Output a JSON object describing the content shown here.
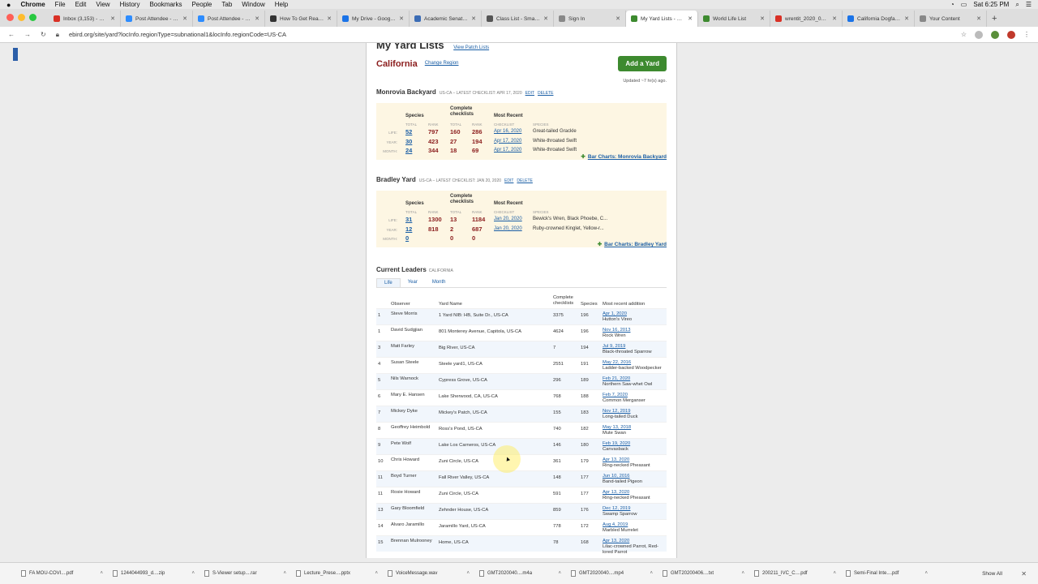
{
  "menubar": {
    "app": "Chrome",
    "items": [
      "File",
      "Edit",
      "View",
      "History",
      "Bookmarks",
      "People",
      "Tab",
      "Window",
      "Help"
    ],
    "clock": "Sat 6:25 PM"
  },
  "tabs": [
    {
      "label": "Inbox (3,153) - dev...",
      "color": "#d93025"
    },
    {
      "label": "Post Attendee - Zo...",
      "color": "#2d8cff"
    },
    {
      "label": "Post Attendee - Zo...",
      "color": "#2d8cff"
    },
    {
      "label": "How To Get Really...",
      "color": "#333333"
    },
    {
      "label": "My Drive - Google D...",
      "color": "#1a73e8"
    },
    {
      "label": "Academic Senate -...",
      "color": "#3b6cb5"
    },
    {
      "label": "Class List - Smartsh...",
      "color": "#555555"
    },
    {
      "label": "Sign In",
      "color": "#888888"
    },
    {
      "label": "My Yard Lists - eBi...",
      "color": "#3d8a2f",
      "active": true
    },
    {
      "label": "World Life List",
      "color": "#3d8a2f"
    },
    {
      "label": "wrentit_2020_04.p...",
      "color": "#d93025"
    },
    {
      "label": "California Dogface...",
      "color": "#1a73e8"
    },
    {
      "label": "Your Content",
      "color": "#888888"
    }
  ],
  "address": {
    "url": "ebird.org/site/yard?locInfo.regionType=subnational1&locInfo.regionCode=US-CA"
  },
  "page": {
    "title": "My Yard Lists",
    "view_patch": "View Patch Lists",
    "region": "California",
    "change_region": "Change Region",
    "add_yard": "Add a Yard",
    "updated": "Updated ~7 hr(s) ago."
  },
  "yards": [
    {
      "name": "Monrovia Backyard",
      "meta": "US-CA – LATEST CHECKLIST: APR 17, 2020",
      "edit": "EDIT",
      "delete": "DELETE",
      "hdr": {
        "species": "Species",
        "checklists": "Complete checklists",
        "recent": "Most Recent"
      },
      "sub": {
        "total": "TOTAL",
        "rank": "RANK",
        "checklist": "CHECKLIST",
        "species": "SPECIES"
      },
      "rows": [
        {
          "label": "LIFE:",
          "total": "52",
          "rank": "797",
          "ctotal": "160",
          "crank": "286",
          "date": "Apr 16, 2020",
          "species": "Great-tailed Grackle"
        },
        {
          "label": "YEAR:",
          "total": "30",
          "rank": "423",
          "ctotal": "27",
          "crank": "194",
          "date": "Apr 17, 2020",
          "species": "White-throated Swift"
        },
        {
          "label": "MONTH:",
          "total": "24",
          "rank": "344",
          "ctotal": "18",
          "crank": "69",
          "date": "Apr 17, 2020",
          "species": "White-throated Swift"
        }
      ],
      "bar": "Bar Charts: Monrovia Backyard"
    },
    {
      "name": "Bradley Yard",
      "meta": "US-CA – LATEST CHECKLIST: JAN 20, 2020",
      "edit": "EDIT",
      "delete": "DELETE",
      "hdr": {
        "species": "Species",
        "checklists": "Complete checklists",
        "recent": "Most Recent"
      },
      "sub": {
        "total": "TOTAL",
        "rank": "RANK",
        "checklist": "CHECKLIST",
        "species": "SPECIES"
      },
      "rows": [
        {
          "label": "LIFE:",
          "total": "31",
          "rank": "1300",
          "ctotal": "13",
          "crank": "1184",
          "date": "Jan 20, 2020",
          "species": "Bewick's Wren, Black Phoebe, C..."
        },
        {
          "label": "YEAR:",
          "total": "12",
          "rank": "818",
          "ctotal": "2",
          "crank": "687",
          "date": "Jan 20, 2020",
          "species": "Ruby-crowned Kinglet, Yellow-r..."
        },
        {
          "label": "MONTH:",
          "total": "0",
          "rank": "",
          "ctotal": "0",
          "crank": "0",
          "date": "",
          "species": ""
        }
      ],
      "bar": "Bar Charts: Bradley Yard"
    }
  ],
  "leaders": {
    "title": "Current Leaders",
    "region": "CALIFORNIA",
    "tabs": [
      "Life",
      "Year",
      "Month"
    ],
    "headers": {
      "observer": "Observer",
      "yard": "Yard Name",
      "checklists": "Complete checklists",
      "species": "Species",
      "recent": "Most recent addition"
    },
    "rows": [
      {
        "rank": "1",
        "observer": "Steve Morris",
        "yard": "1 Yard NIB: HB, Suite Dr., US-CA",
        "checklists": "3375",
        "species": "196",
        "date": "Apr 1, 2020",
        "bird": "Hutton's Vireo"
      },
      {
        "rank": "1",
        "observer": "David Sudgjian",
        "yard": "801 Monterey Avenue, Capitola, US-CA",
        "checklists": "4624",
        "species": "196",
        "date": "Nov 16, 2013",
        "bird": "Rock Wren"
      },
      {
        "rank": "3",
        "observer": "Matt Farley",
        "yard": "Big River, US-CA",
        "checklists": "7",
        "species": "194",
        "date": "Jul 9, 2019",
        "bird": "Black-throated Sparrow"
      },
      {
        "rank": "4",
        "observer": "Susan Steele",
        "yard": "Steele yard1, US-CA",
        "checklists": "2551",
        "species": "191",
        "date": "May 22, 2016",
        "bird": "Ladder-backed Woodpecker"
      },
      {
        "rank": "5",
        "observer": "Nils Warnock",
        "yard": "Cypress Grove, US-CA",
        "checklists": "296",
        "species": "189",
        "date": "Feb 21, 2020",
        "bird": "Northern Saw-whet Owl"
      },
      {
        "rank": "6",
        "observer": "Mary E. Hansen",
        "yard": "Lake Sherwood, CA, US-CA",
        "checklists": "768",
        "species": "188",
        "date": "Feb 7, 2020",
        "bird": "Common Merganser"
      },
      {
        "rank": "7",
        "observer": "Mickey Dyke",
        "yard": "Mickey's Patch, US-CA",
        "checklists": "155",
        "species": "183",
        "date": "Nov 12, 2019",
        "bird": "Long-tailed Duck"
      },
      {
        "rank": "8",
        "observer": "Geoffrey Heimbold",
        "yard": "Ross's Pond, US-CA",
        "checklists": "740",
        "species": "182",
        "date": "May 13, 2018",
        "bird": "Mute Swan"
      },
      {
        "rank": "9",
        "observer": "Pete Wolf",
        "yard": "Lake Los Carneros, US-CA",
        "checklists": "146",
        "species": "180",
        "date": "Feb 19, 2020",
        "bird": "Canvasback"
      },
      {
        "rank": "10",
        "observer": "Chris Howard",
        "yard": "Zuni Circle, US-CA",
        "checklists": "361",
        "species": "179",
        "date": "Apr 13, 2020",
        "bird": "Ring-necked Pheasant"
      },
      {
        "rank": "11",
        "observer": "Boyd Turner",
        "yard": "Fall River Valley, US-CA",
        "checklists": "148",
        "species": "177",
        "date": "Jun 10, 2016",
        "bird": "Band-tailed Pigeon"
      },
      {
        "rank": "11",
        "observer": "Rosie Howard",
        "yard": "Zuni Circle, US-CA",
        "checklists": "591",
        "species": "177",
        "date": "Apr 13, 2020",
        "bird": "Ring-necked Pheasant"
      },
      {
        "rank": "13",
        "observer": "Gary Bloomfield",
        "yard": "Zehnder House, US-CA",
        "checklists": "859",
        "species": "176",
        "date": "Dec 12, 2019",
        "bird": "Swamp Sparrow"
      },
      {
        "rank": "14",
        "observer": "Alvaro Jaramillo",
        "yard": "Jaramillo Yard, US-CA",
        "checklists": "778",
        "species": "172",
        "date": "Aug 4, 2019",
        "bird": "Marbled Murrelet"
      },
      {
        "rank": "15",
        "observer": "Brennan Mulrooney",
        "yard": "Home, US-CA",
        "checklists": "78",
        "species": "168",
        "date": "Apr 13, 2020",
        "bird": "Lilac-crowned Parrot, Red-lored Parrot"
      }
    ]
  },
  "downloads": [
    "FA MOU-COVI....pdf",
    "1244044993_d....zip",
    "S-Viewer setup....rar",
    "Lecture_Prese....pptx",
    "VoiceMessage.wav",
    "GMT2020040....m4a",
    "GMT2020040....mp4",
    "GMT20200406....txt",
    "200211_IVC_C....pdf",
    "Semi-Final Inte....pdf"
  ],
  "show_all": "Show All"
}
